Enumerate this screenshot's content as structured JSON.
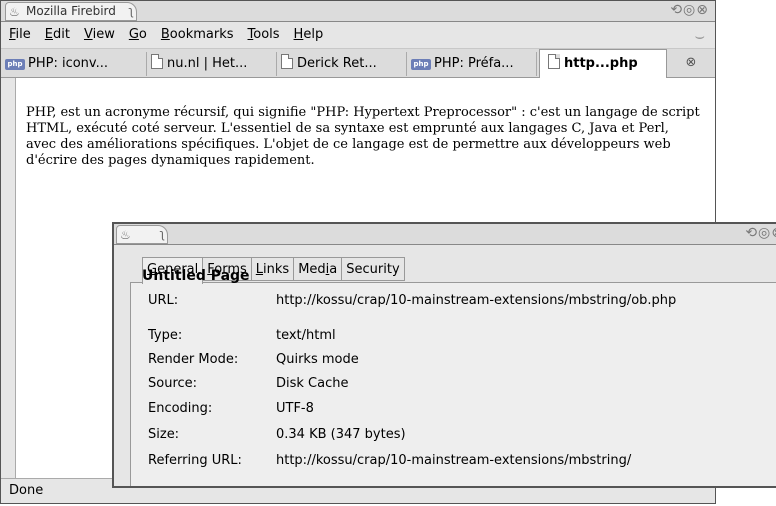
{
  "window": {
    "title": "Mozilla Firebird"
  },
  "menu": {
    "items": [
      {
        "accel": "F",
        "rest": "ile"
      },
      {
        "accel": "E",
        "rest": "dit"
      },
      {
        "accel": "V",
        "rest": "iew"
      },
      {
        "accel": "G",
        "rest": "o"
      },
      {
        "accel": "B",
        "rest": "ookmarks"
      },
      {
        "accel": "T",
        "rest": "ools"
      },
      {
        "accel": "H",
        "rest": "elp"
      }
    ]
  },
  "tabs": [
    {
      "label": "PHP: iconv...",
      "icon": "php-icon"
    },
    {
      "label": "nu.nl | Het...",
      "icon": "page-icon"
    },
    {
      "label": "Derick Ret...",
      "icon": "page-icon"
    },
    {
      "label": "PHP: Préfa...",
      "icon": "php-icon"
    },
    {
      "label": "http...php",
      "icon": "page-icon",
      "active": true
    }
  ],
  "php_icon_text": "php",
  "content": {
    "paragraph": "PHP, est un acronyme récursif, qui signifie \"PHP: Hypertext Preprocessor\" : c'est un langage de script HTML, exécuté coté serveur. L'essentiel de sa syntaxe est emprunté aux langages C, Java et Perl, avec des améliorations spécifiques. L'objet de ce langage est de permettre aux développeurs web d'écrire des pages dynamiques rapidement."
  },
  "status": {
    "text": "Done"
  },
  "page_info": {
    "tabs": [
      {
        "pre": "",
        "accel": "G",
        "post": "eneral",
        "active": true
      },
      {
        "pre": "",
        "accel": "F",
        "post": "orms"
      },
      {
        "pre": "",
        "accel": "L",
        "post": "inks"
      },
      {
        "pre": "Med",
        "accel": "i",
        "post": "a"
      },
      {
        "pre": "Security",
        "accel": "",
        "post": ""
      }
    ],
    "page_title": "Untitled Page",
    "rows": [
      {
        "label": "URL:",
        "value": "http://kossu/crap/10-mainstream-extensions/mbstring/ob.php"
      },
      {
        "label": "Type:",
        "value": "text/html"
      },
      {
        "label": "Render Mode:",
        "value": "Quirks mode"
      },
      {
        "label": "Source:",
        "value": "Disk Cache"
      },
      {
        "label": "Encoding:",
        "value": "UTF-8"
      },
      {
        "label": "Size:",
        "value": "0.34 KB (347 bytes)"
      },
      {
        "label": "Referring URL:",
        "value": "http://kossu/crap/10-mainstream-extensions/mbstring/"
      }
    ]
  },
  "icons": {
    "wm_buttons": "⟲◎⊗",
    "title_logo": "♨",
    "title_curl": "ʅ",
    "throbber": "⌣",
    "tab_close": "⊗"
  }
}
